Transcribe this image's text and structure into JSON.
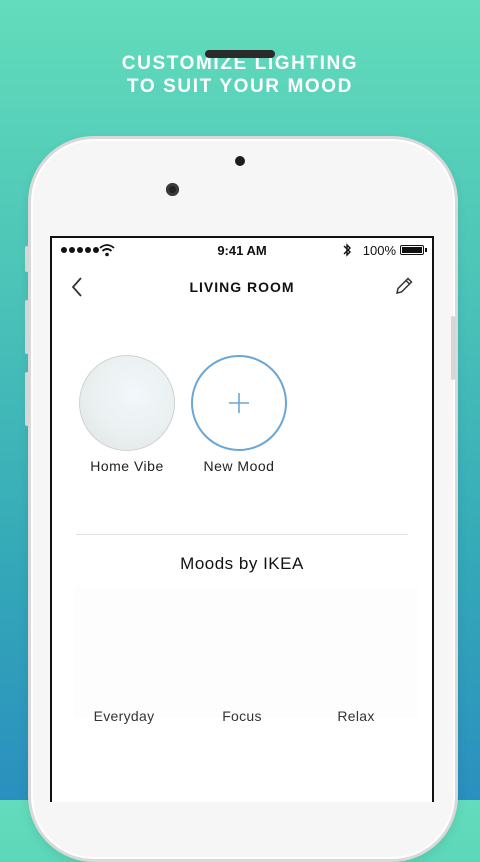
{
  "headline": {
    "line1": "CUSTOMIZE LIGHTING",
    "line2": "TO SUIT YOUR MOOD"
  },
  "status_bar": {
    "time": "9:41 AM",
    "battery_text": "100%",
    "battery_level": 1.0,
    "signal_dots": 5
  },
  "nav": {
    "title": "LIVING ROOM",
    "back_icon": "chevron-left-icon",
    "edit_icon": "pencil-icon"
  },
  "moods": [
    {
      "label": "Home Vibe",
      "icon": "mood-circle"
    },
    {
      "label": "New Mood",
      "icon": "plus-icon"
    }
  ],
  "section": {
    "title": "Moods by IKEA",
    "items": [
      {
        "label": "Everyday"
      },
      {
        "label": "Focus"
      },
      {
        "label": "Relax"
      }
    ]
  },
  "colors": {
    "accent": "#6aa6d6",
    "background_top": "#62dcbb",
    "background_bottom": "#2a8fbf"
  }
}
